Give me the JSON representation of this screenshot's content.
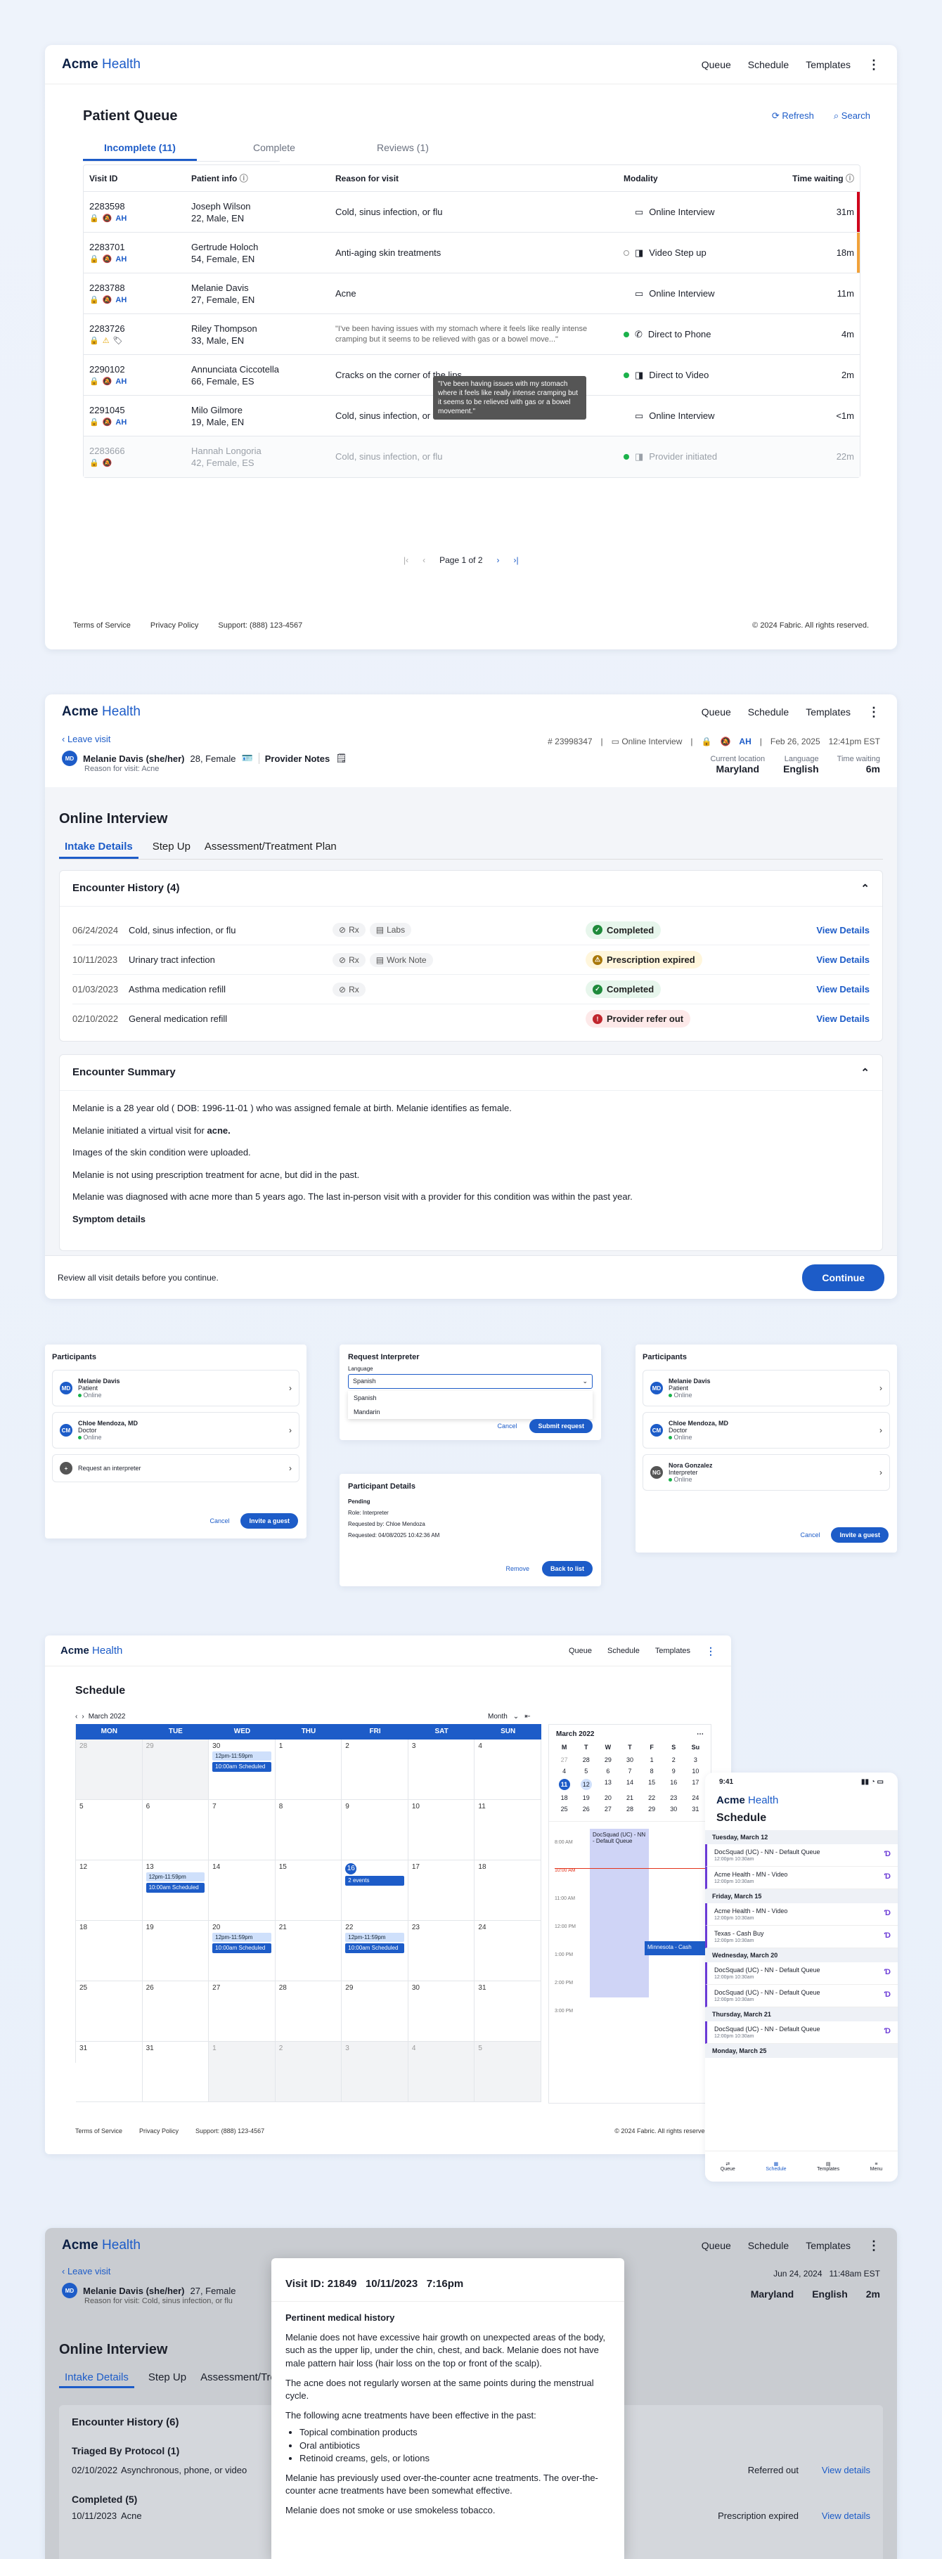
{
  "brand": {
    "name": "Acme",
    "suffix": "Health"
  },
  "nav": {
    "queue": "Queue",
    "schedule": "Schedule",
    "templates": "Templates"
  },
  "queue": {
    "title": "Patient Queue",
    "refresh": "Refresh",
    "search": "Search",
    "tabs": [
      "Incomplete (11)",
      "Complete",
      "Reviews (1)"
    ],
    "headers": {
      "visit": "Visit ID",
      "patient": "Patient info",
      "reason": "Reason for visit",
      "modality": "Modality",
      "time": "Time waiting"
    },
    "rows": [
      {
        "id": "2283598",
        "name": "Joseph Wilson",
        "info": "22, Male, EN",
        "reason": "Cold, sinus infection, or flu",
        "modality": "Online Interview",
        "time": "31m",
        "flag": "#d0021b"
      },
      {
        "id": "2283701",
        "name": "Gertrude Holoch",
        "info": "54, Female, EN",
        "reason": "Anti-aging skin treatments",
        "modality": "Video Step up",
        "time": "18m",
        "flag": "#f2a23a"
      },
      {
        "id": "2283788",
        "name": "Melanie Davis",
        "info": "27, Female, EN",
        "reason": "Acne",
        "modality": "Online Interview",
        "time": "11m",
        "flag": ""
      },
      {
        "id": "2283726",
        "name": "Riley Thompson",
        "info": "33, Male, EN",
        "reason": "\"I've been having issues with my stomach where it feels like really intense cramping but it seems to be relieved with gas or a bowel move...\"",
        "modality": "Direct to Phone",
        "time": "4m",
        "flag": ""
      },
      {
        "id": "2290102",
        "name": "Annunciata Ciccotella",
        "info": "66, Female, ES",
        "reason": "Cracks on the corner of the lips",
        "modality": "Direct to Video",
        "time": "2m",
        "flag": ""
      },
      {
        "id": "2291045",
        "name": "Milo Gilmore",
        "info": "19, Male, EN",
        "reason": "Cold, sinus infection, or flu",
        "modality": "Online Interview",
        "time": "<1m",
        "flag": ""
      },
      {
        "id": "2283666",
        "name": "Hannah Longoria",
        "info": "42, Female, ES",
        "reason": "Cold, sinus infection, or flu",
        "modality": "Provider initiated",
        "time": "22m",
        "flag": ""
      }
    ],
    "tooltip": "\"I've been having issues with my stomach where it feels like really intense cramping but it seems to be relieved with gas or a bowel movement.\"",
    "pagination": "Page 1 of 2"
  },
  "footer": {
    "tos": "Terms of Service",
    "privacy": "Privacy Policy",
    "support": "Support: (888) 123-4567",
    "copyright": "© 2024 Fabric. All rights reserved."
  },
  "visit": {
    "leave": "Leave visit",
    "initials": "MD",
    "patient": "Melanie Davis (she/her)",
    "demo": "28, Female",
    "notes": "Provider Notes",
    "reason": "Reason for visit: Acne",
    "id": "# 23998347",
    "modality": "Online Interview",
    "date": "Feb 26, 2025",
    "time": "12:41pm EST",
    "loc_label": "Current location",
    "loc": "Maryland",
    "lang_label": "Language",
    "lang": "English",
    "wait_label": "Time waiting",
    "wait": "6m",
    "heading": "Online Interview",
    "tabs": [
      "Intake Details",
      "Step Up",
      "Assessment/Treatment Plan"
    ],
    "history_title": "Encounter History (4)",
    "history": [
      {
        "date": "06/24/2024",
        "reason": "Cold, sinus infection, or flu",
        "tags": [
          "Rx",
          "Labs"
        ],
        "status": "Completed",
        "color": "green"
      },
      {
        "date": "10/11/2023",
        "reason": "Urinary tract infection",
        "tags": [
          "Rx",
          "Work Note"
        ],
        "status": "Prescription expired",
        "color": "yellow"
      },
      {
        "date": "01/03/2023",
        "reason": "Asthma medication refill",
        "tags": [
          "Rx"
        ],
        "status": "Completed",
        "color": "green"
      },
      {
        "date": "02/10/2022",
        "reason": "General medication refill",
        "tags": [],
        "status": "Provider refer out",
        "color": "red"
      }
    ],
    "view": "View Details",
    "summary_title": "Encounter Summary",
    "summary": [
      "Melanie is a 28 year old ( DOB: 1996-11-01 ) who was assigned female at birth. Melanie identifies as female.",
      "Melanie initiated a virtual visit for",
      "Images of the skin condition were uploaded.",
      "Melanie is not using prescription treatment for acne, but did in the past.",
      "Melanie was diagnosed with acne more than 5 years ago. The last in-person visit with a provider for this condition was within the past year."
    ],
    "summary_acne": "acne.",
    "symptom": "Symptom details",
    "review": "Review all visit details before you continue.",
    "continue": "Continue"
  },
  "participants": {
    "title": "Participants",
    "p1": "Melanie Davis",
    "p1r": "Patient",
    "p2": "Chloe Mendoza, MD",
    "p2r": "Doctor",
    "p3": "Nora Gonzalez",
    "p3r": "Interpreter",
    "online": "Online",
    "request": "Request an interpreter",
    "cancel": "Cancel",
    "invite": "Invite a guest",
    "ri_title": "Request Interpreter",
    "ri_label": "Language",
    "ri_value": "Spanish",
    "ri_opts": [
      "Spanish",
      "Mandarin"
    ],
    "ri_submit": "Submit request",
    "pd_title": "Participant Details",
    "pd_status": "Pending",
    "pd_role": "Role: Interpreter",
    "pd_by": "Requested by: Chloe Mendoza",
    "pd_at": "Requested: 04/08/2025 10:42:36 AM",
    "pd_remove": "Remove",
    "pd_back": "Back to list"
  },
  "schedule": {
    "title": "Schedule",
    "month": "March 2022",
    "view": "Month",
    "days": [
      "MON",
      "TUE",
      "WED",
      "THU",
      "FRI",
      "SAT",
      "SUN"
    ],
    "weeks": [
      [
        "28",
        "1",
        "2",
        "3",
        "4",
        "5",
        "6"
      ],
      [
        "7",
        "8",
        "9",
        "10",
        "11",
        "12",
        "13"
      ],
      [
        "14",
        "15",
        "16",
        "17",
        "18",
        "19",
        "20"
      ],
      [
        "21",
        "22",
        "23",
        "24",
        "25",
        "26",
        "27"
      ],
      [
        "28",
        "29",
        "30",
        "31",
        "1",
        "2",
        "3"
      ]
    ],
    "wk": [
      [
        "28",
        "29",
        "30",
        "1",
        "2",
        "3",
        "4"
      ],
      [
        "5",
        "6",
        "7",
        "8",
        "9",
        "10",
        "11"
      ],
      [
        "12",
        "13",
        "14",
        "15",
        "16",
        "17",
        "18"
      ],
      [
        "18",
        "19",
        "20",
        "21",
        "22",
        "23",
        "24"
      ],
      [
        "25",
        "26",
        "27",
        "28",
        "29",
        "30",
        "31"
      ],
      [
        "31",
        "31",
        "1",
        "2",
        "3",
        "4",
        "5"
      ]
    ],
    "evtA": "12pm-11:59pm",
    "evtB": "10:00am Scheduled",
    "twoEvents": "2 events",
    "mini_days": [
      "M",
      "T",
      "W",
      "T",
      "F",
      "S",
      "Su"
    ],
    "mini": [
      [
        "27",
        "28",
        "29",
        "30",
        "1",
        "2",
        "3"
      ],
      [
        "4",
        "5",
        "6",
        "7",
        "8",
        "9",
        "10"
      ],
      [
        "11",
        "12",
        "13",
        "14",
        "15",
        "16",
        "17"
      ],
      [
        "18",
        "19",
        "20",
        "21",
        "22",
        "23",
        "24"
      ],
      [
        "25",
        "26",
        "27",
        "28",
        "29",
        "30",
        "31"
      ]
    ],
    "hours": [
      "8:00 AM",
      "10:00 AM",
      "11:00 AM",
      "12:00 PM",
      "1:00 PM",
      "2:00 PM",
      "3:00 PM"
    ],
    "block": "DocSquad (UC) - NN - Default Queue",
    "block2": "Minnesota - Cash"
  },
  "mobile": {
    "time": "9:41",
    "title": "Schedule",
    "groups": [
      {
        "day": "Tuesday, March 12",
        "items": [
          "DocSquad (UC) - NN - Default Queue",
          "Acme Health - MN - Video"
        ]
      },
      {
        "day": "Friday, March 15",
        "items": [
          "Acme Health - MN - Video",
          "Texas - Cash Buy"
        ]
      },
      {
        "day": "Wednesday, March 20",
        "items": [
          "DocSquad (UC) - NN - Default Queue",
          "DocSquad (UC) - NN - Default Queue"
        ]
      },
      {
        "day": "Thursday, March 21",
        "items": [
          "DocSquad (UC) - NN - Default Queue"
        ]
      },
      {
        "day": "Monday, March 25",
        "items": []
      }
    ],
    "itime": "12:00pm 10:30am",
    "tabs": [
      "Queue",
      "Schedule",
      "Templates",
      "Menu"
    ]
  },
  "modal": {
    "title": "Visit ID: 21849   10/11/2023   7:16pm",
    "section": "Pertinent medical history",
    "p1": "Melanie does not have excessive hair growth on unexpected areas of the body, such as the upper lip, under the chin, chest, and back. Melanie does not have male pattern hair loss (hair loss on the top or front of the scalp).",
    "p2": "The acne does not regularly worsen at the same points during the menstrual cycle.",
    "p3": "The following acne treatments have been effective in the past:",
    "list": [
      "Topical combination products",
      "Oral antibiotics",
      "Retinoid creams, gels, or lotions"
    ],
    "p4": "Melanie has previously used over-the-counter acne treatments. The over-the-counter acne treatments have been somewhat effective.",
    "p5": "Melanie does not smoke or use smokeless tobacco."
  },
  "bg5": {
    "leave": "Leave visit",
    "patient": "Melanie Davis (she/her)",
    "demo": "27, Female",
    "reason": "Reason for visit: Cold, sinus infection, or flu",
    "date": "Jun 24, 2024",
    "time": "11:48am EST",
    "loc": "Maryland",
    "lang": "English",
    "wait": "2m",
    "heading": "Online Interview",
    "history": "Encounter History (6)",
    "triaged": "Triaged By Protocol (1)",
    "tdate": "02/10/2022",
    "treason": "Asynchronous, phone, or video",
    "treferred": "Referred out",
    "completed": "Completed (5)",
    "cdate": "10/11/2023",
    "creason": "Acne",
    "cstatus": "Prescription expired",
    "view": "View details"
  }
}
